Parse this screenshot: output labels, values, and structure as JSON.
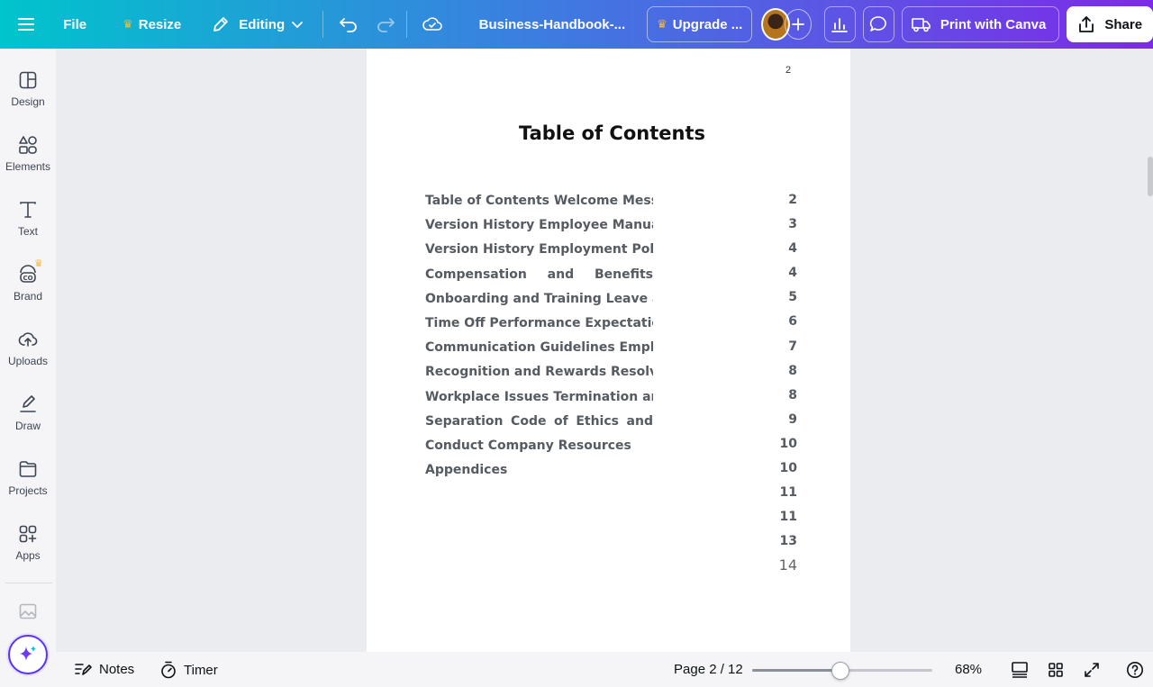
{
  "topbar": {
    "file_label": "File",
    "resize_label": "Resize",
    "editing_label": "Editing",
    "doc_title": "Business-Handbook-...",
    "upgrade_label": "Upgrade ...",
    "print_label": "Print with Canva",
    "share_label": "Share",
    "crown_color": "#f5b740"
  },
  "sidebar": {
    "items": [
      {
        "label": "Design",
        "icon": "design-icon"
      },
      {
        "label": "Elements",
        "icon": "elements-icon"
      },
      {
        "label": "Text",
        "icon": "text-icon"
      },
      {
        "label": "Brand",
        "icon": "brand-icon"
      },
      {
        "label": "Uploads",
        "icon": "uploads-icon"
      },
      {
        "label": "Draw",
        "icon": "draw-icon"
      },
      {
        "label": "Projects",
        "icon": "projects-icon"
      },
      {
        "label": "Apps",
        "icon": "apps-icon"
      }
    ]
  },
  "document": {
    "page_number": "2",
    "toc_title": "Table of Contents",
    "toc_lines": [
      "Table of Contents Welcome Message",
      "Version History Employee Manual",
      "Version History Employment Policies",
      "Compensation and Benefits",
      "Onboarding and Training Leave and",
      "Time Off Performance Expectations",
      "Communication Guidelines Employee",
      "Recognition and Rewards Resolving",
      "Workplace Issues Termination and",
      "Separation Code of Ethics and",
      "Conduct Company Resources",
      "Appendices"
    ],
    "toc_numbers": [
      "2",
      "3",
      "4",
      "4",
      "5",
      "6",
      "7",
      "8",
      "8",
      "9",
      "10",
      "10",
      "11",
      "11",
      "13",
      "14"
    ]
  },
  "bottombar": {
    "notes_label": "Notes",
    "timer_label": "Timer",
    "page_indicator": "Page 2 / 12",
    "zoom_label": "68%",
    "zoom_fraction": 0.49
  }
}
